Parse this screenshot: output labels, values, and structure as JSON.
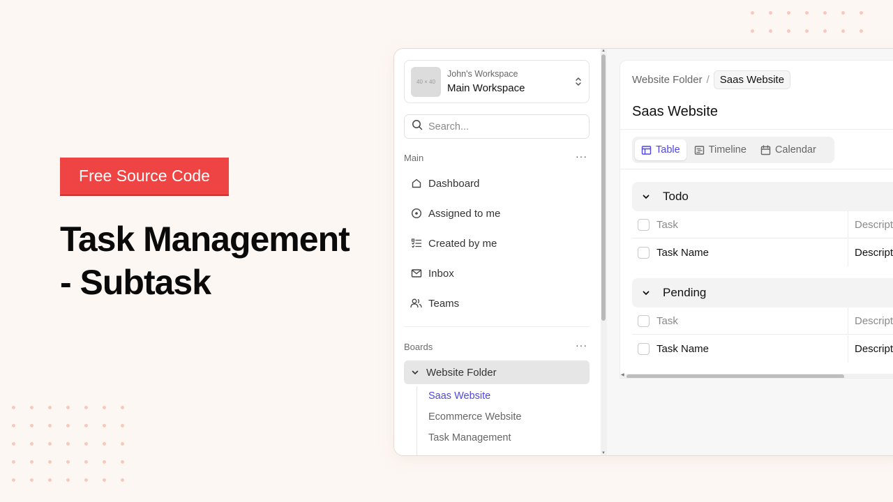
{
  "hero": {
    "badge": "Free Source Code",
    "title": "Task Management - Subtask"
  },
  "colors": {
    "accent": "#4f46e5",
    "badge": "#ef4444",
    "background": "#fdf7f3"
  },
  "workspace": {
    "avatar_placeholder": "40 × 40",
    "owner": "John's Workspace",
    "name": "Main Workspace",
    "toggle_icon": "chevron-up-down-icon"
  },
  "search": {
    "placeholder": "Search..."
  },
  "sidebar": {
    "main_label": "Main",
    "more": "···",
    "items": [
      {
        "label": "Dashboard",
        "icon": "home-icon"
      },
      {
        "label": "Assigned to me",
        "icon": "circle-dot-icon"
      },
      {
        "label": "Created by me",
        "icon": "list-check-icon"
      },
      {
        "label": "Inbox",
        "icon": "mail-icon"
      },
      {
        "label": "Teams",
        "icon": "users-icon"
      }
    ],
    "boards_label": "Boards",
    "folder": "Website Folder",
    "boards": [
      {
        "label": "Saas Website",
        "active": true
      },
      {
        "label": "Ecommerce Website",
        "active": false
      },
      {
        "label": "Task Management",
        "active": false
      }
    ]
  },
  "main": {
    "breadcrumb": [
      "Website Folder",
      "Saas Website"
    ],
    "breadcrumb_sep": "/",
    "title": "Saas Website",
    "views": [
      {
        "label": "Table",
        "icon": "table-icon",
        "active": true
      },
      {
        "label": "Timeline",
        "icon": "timeline-icon",
        "active": false
      },
      {
        "label": "Calendar",
        "icon": "calendar-icon",
        "active": false
      }
    ],
    "groups": [
      {
        "name": "Todo",
        "col_task": "Task",
        "col_desc": "Descript",
        "row_task": "Task Name",
        "row_desc": "Descript"
      },
      {
        "name": "Pending",
        "col_task": "Task",
        "col_desc": "Descript",
        "row_task": "Task Name",
        "row_desc": "Descript"
      }
    ]
  }
}
